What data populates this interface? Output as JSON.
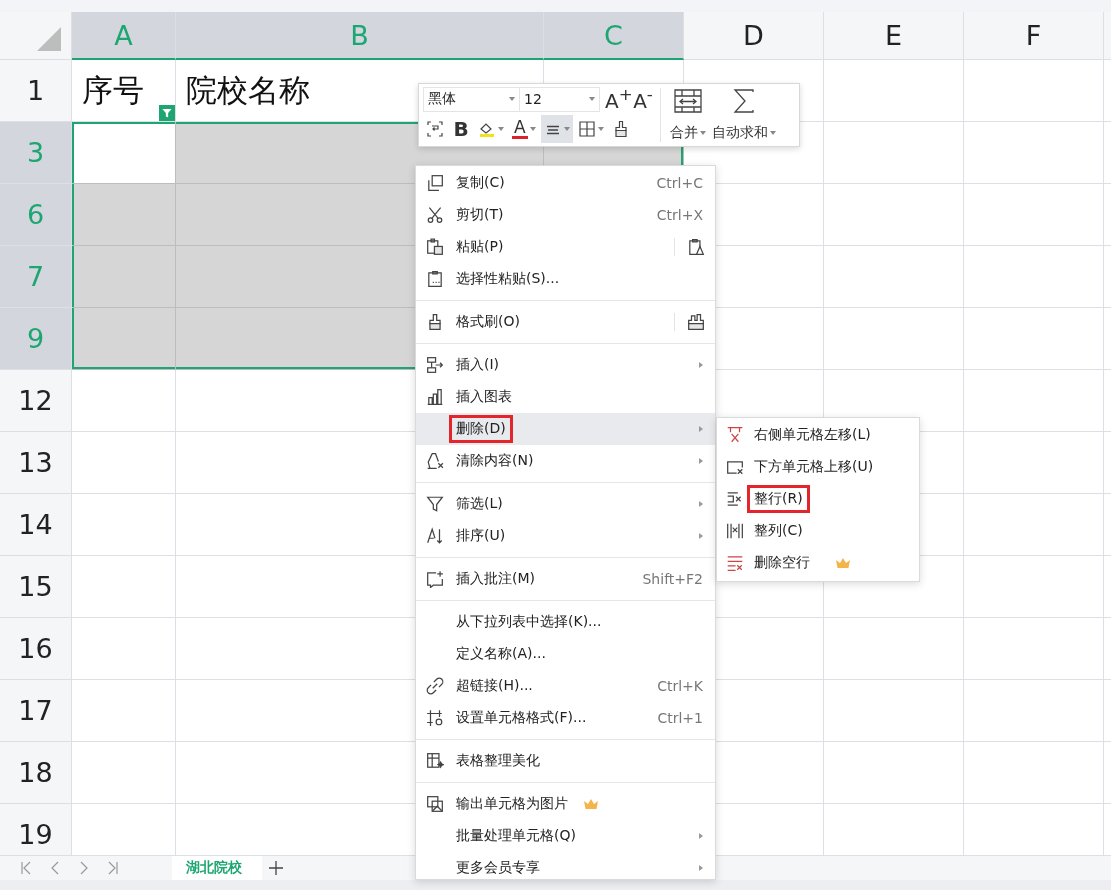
{
  "columns": [
    {
      "label": "A",
      "selected": true
    },
    {
      "label": "B",
      "selected": true
    },
    {
      "label": "C",
      "selected": true
    },
    {
      "label": "D",
      "selected": false
    },
    {
      "label": "E",
      "selected": false
    },
    {
      "label": "F",
      "selected": false
    }
  ],
  "rows": [
    {
      "label": "1",
      "selected": false,
      "filter": true,
      "cells": [
        "序号",
        "院校名称"
      ]
    },
    {
      "label": "3",
      "selected": true,
      "filter": false
    },
    {
      "label": "6",
      "selected": true,
      "filter": false
    },
    {
      "label": "7",
      "selected": true,
      "filter": false
    },
    {
      "label": "9",
      "selected": true,
      "filter": false
    },
    {
      "label": "12",
      "selected": false,
      "filter": false
    },
    {
      "label": "13",
      "selected": false,
      "filter": false
    },
    {
      "label": "14",
      "selected": false,
      "filter": false
    },
    {
      "label": "15",
      "selected": false,
      "filter": false
    },
    {
      "label": "16",
      "selected": false,
      "filter": false
    },
    {
      "label": "17",
      "selected": false,
      "filter": false
    },
    {
      "label": "18",
      "selected": false,
      "filter": false
    },
    {
      "label": "19",
      "selected": false,
      "filter": false
    }
  ],
  "mini_toolbar": {
    "font_name": "黑体",
    "font_size": "12",
    "grow_font": "A$^{+}$",
    "shrink_font": "A$^{-}$",
    "merge_label": "合并",
    "autosum_label": "自动求和",
    "buttons": [
      {
        "kind": "wrap",
        "selected": false,
        "dropdown": false
      },
      {
        "kind": "bold",
        "text": "B",
        "selected": false,
        "dropdown": false
      },
      {
        "kind": "fill_color",
        "selected": false,
        "dropdown": true
      },
      {
        "kind": "font_color",
        "text": "A",
        "selected": false,
        "dropdown": true
      },
      {
        "kind": "align",
        "selected": true,
        "dropdown": true
      },
      {
        "kind": "borders",
        "selected": false,
        "dropdown": true
      },
      {
        "kind": "format_painter",
        "selected": false,
        "dropdown": false
      }
    ]
  },
  "context_menu": [
    {
      "kind": "item",
      "label": "复制(C)",
      "shortcut": "Ctrl+C",
      "submenu": false,
      "selected": false,
      "annotated": false,
      "premium": false,
      "quick_action": false
    },
    {
      "kind": "item",
      "label": "剪切(T)",
      "shortcut": "Ctrl+X",
      "submenu": false,
      "selected": false,
      "annotated": false,
      "premium": false,
      "quick_action": false
    },
    {
      "kind": "item",
      "label": "粘贴(P)",
      "submenu": false,
      "selected": false,
      "annotated": false,
      "premium": false,
      "quick_action": true
    },
    {
      "kind": "item",
      "label": "选择性粘贴(S)...",
      "submenu": false,
      "selected": false,
      "annotated": false,
      "premium": false,
      "quick_action": false
    },
    {
      "kind": "separator"
    },
    {
      "kind": "item",
      "label": "格式刷(O)",
      "submenu": false,
      "selected": false,
      "annotated": false,
      "premium": false,
      "quick_action": true
    },
    {
      "kind": "separator"
    },
    {
      "kind": "item",
      "label": "插入(I)",
      "submenu": true,
      "selected": false,
      "annotated": false,
      "premium": false,
      "quick_action": false
    },
    {
      "kind": "item",
      "label": "插入图表",
      "submenu": false,
      "selected": false,
      "annotated": false,
      "premium": false,
      "quick_action": false
    },
    {
      "kind": "item",
      "label": "删除(D)",
      "submenu": true,
      "selected": true,
      "annotated": true,
      "premium": false,
      "quick_action": false
    },
    {
      "kind": "item",
      "label": "清除内容(N)",
      "submenu": true,
      "selected": false,
      "annotated": false,
      "premium": false,
      "quick_action": false
    },
    {
      "kind": "separator"
    },
    {
      "kind": "item",
      "label": "筛选(L)",
      "submenu": true,
      "selected": false,
      "annotated": false,
      "premium": false,
      "quick_action": false
    },
    {
      "kind": "item",
      "label": "排序(U)",
      "submenu": true,
      "selected": false,
      "annotated": false,
      "premium": false,
      "quick_action": false
    },
    {
      "kind": "separator"
    },
    {
      "kind": "item",
      "label": "插入批注(M)",
      "shortcut": "Shift+F2",
      "submenu": false,
      "selected": false,
      "annotated": false,
      "premium": false,
      "quick_action": false
    },
    {
      "kind": "separator"
    },
    {
      "kind": "item",
      "label": "从下拉列表中选择(K)...",
      "submenu": false,
      "selected": false,
      "annotated": false,
      "premium": false,
      "quick_action": false
    },
    {
      "kind": "item",
      "label": "定义名称(A)...",
      "submenu": false,
      "selected": false,
      "annotated": false,
      "premium": false,
      "quick_action": false
    },
    {
      "kind": "item",
      "label": "超链接(H)...",
      "shortcut": "Ctrl+K",
      "submenu": false,
      "selected": false,
      "annotated": false,
      "premium": false,
      "quick_action": false
    },
    {
      "kind": "item",
      "label": "设置单元格格式(F)...",
      "shortcut": "Ctrl+1",
      "submenu": false,
      "selected": false,
      "annotated": false,
      "premium": false,
      "quick_action": false
    },
    {
      "kind": "separator"
    },
    {
      "kind": "item",
      "label": "表格整理美化",
      "submenu": false,
      "selected": false,
      "annotated": false,
      "premium": false,
      "quick_action": false
    },
    {
      "kind": "separator"
    },
    {
      "kind": "item",
      "label": "输出单元格为图片",
      "submenu": false,
      "selected": false,
      "annotated": false,
      "premium": true,
      "quick_action": false
    },
    {
      "kind": "item",
      "label": "批量处理单元格(Q)",
      "submenu": true,
      "selected": false,
      "annotated": false,
      "premium": false,
      "quick_action": false
    },
    {
      "kind": "item",
      "label": "更多会员专享",
      "submenu": true,
      "selected": false,
      "annotated": false,
      "premium": false,
      "quick_action": false
    }
  ],
  "delete_submenu": [
    {
      "label": "右侧单元格左移(L)",
      "annotated": false,
      "premium": false
    },
    {
      "label": "下方单元格上移(U)",
      "annotated": false,
      "premium": false
    },
    {
      "label": "整行(R)",
      "annotated": true,
      "premium": false
    },
    {
      "label": "整列(C)",
      "annotated": false,
      "premium": false
    },
    {
      "label": "删除空行",
      "annotated": false,
      "premium": true
    }
  ],
  "sheet_tabs": [
    {
      "label": "湖北院校",
      "selected": true
    }
  ]
}
